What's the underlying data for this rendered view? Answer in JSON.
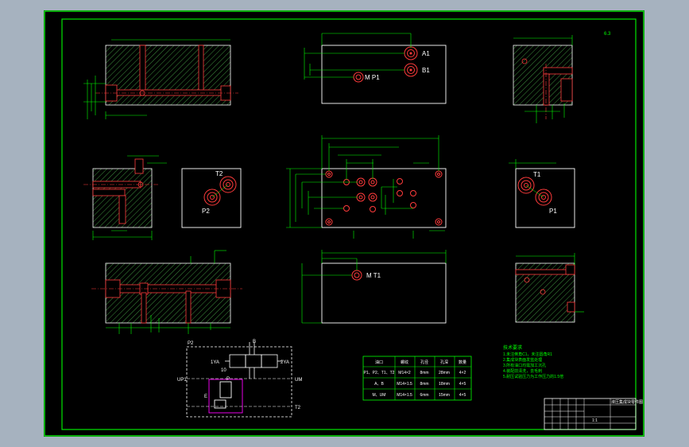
{
  "colors": {
    "window_bg": "#a6b2bf",
    "drawing_bg": "#000000",
    "frame": "#00e600",
    "outline": "#ffffff",
    "dimension": "#00ff00",
    "port": "#ff3b3b",
    "hatch": "#3f8f3f",
    "valve": "#ff00ff",
    "cyan": "#00ffff",
    "yellow": "#ffff00"
  },
  "labels": {
    "a1": "A1",
    "b1": "B1",
    "mp1": "M P1",
    "t2": "T2",
    "p2": "P2",
    "t1": "T1",
    "p1": "P1",
    "mt1": "M T1",
    "valve_p2": "P2",
    "valve_b": "B",
    "valve_ya": "1YA",
    "valve_yb": "2YA",
    "valve_mark": "10",
    "valve_up1": "UP1",
    "valve_um": "UM",
    "valve_t2": "T2",
    "valve_p": "P",
    "valve_e": "E"
  },
  "port_table": {
    "headers": [
      "油口",
      "螺纹",
      "孔径",
      "孔深",
      "数量"
    ],
    "rows": [
      [
        "P1、P2、T1、T2",
        "M14×2",
        "8mm",
        "28mm",
        "4×2"
      ],
      [
        "A、B",
        "M14×1.5",
        "8mm",
        "18mm",
        "4×5"
      ],
      [
        "M、UM",
        "M14×1.5",
        "6mm",
        "15mm",
        "4×5"
      ]
    ]
  },
  "notes": {
    "title": "技术要求",
    "lines": [
      "1.未注倒角C1，未注圆角R1",
      "2.集成块表面发蓝处理",
      "3.所有油口均需加工沉孔",
      "4.装配前清洗，去毛刺",
      "5.耐压试验压力为工作压力的1.5倍"
    ]
  },
  "title_block": {
    "title": "液压集成块零件图",
    "scale": "1:1"
  },
  "roughness": "6.3"
}
